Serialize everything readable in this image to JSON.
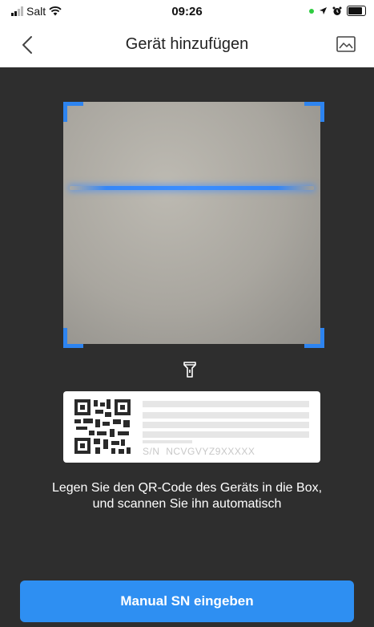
{
  "status_bar": {
    "carrier": "Salt",
    "time": "09:26",
    "icons": [
      "signal-icon",
      "wifi-icon",
      "location-icon",
      "alarm-icon",
      "battery-icon"
    ]
  },
  "nav": {
    "title": "Gerät hinzufügen",
    "back_icon": "chevron-left-icon",
    "gallery_icon": "image-gallery-icon"
  },
  "scanner": {
    "torch_icon": "flashlight-icon",
    "label_sample": {
      "serial_prefix": "S/N",
      "serial_value": "NCVGVYZ9XXXXX"
    },
    "instruction": "Legen Sie den QR-Code des Geräts in die Box, und scannen Sie ihn automatisch"
  },
  "actions": {
    "manual_sn_label": "Manual SN eingeben"
  },
  "colors": {
    "accent": "#2E8FF2",
    "scan_line": "#3A8DFF",
    "scanner_bg": "#2E2E2E"
  }
}
